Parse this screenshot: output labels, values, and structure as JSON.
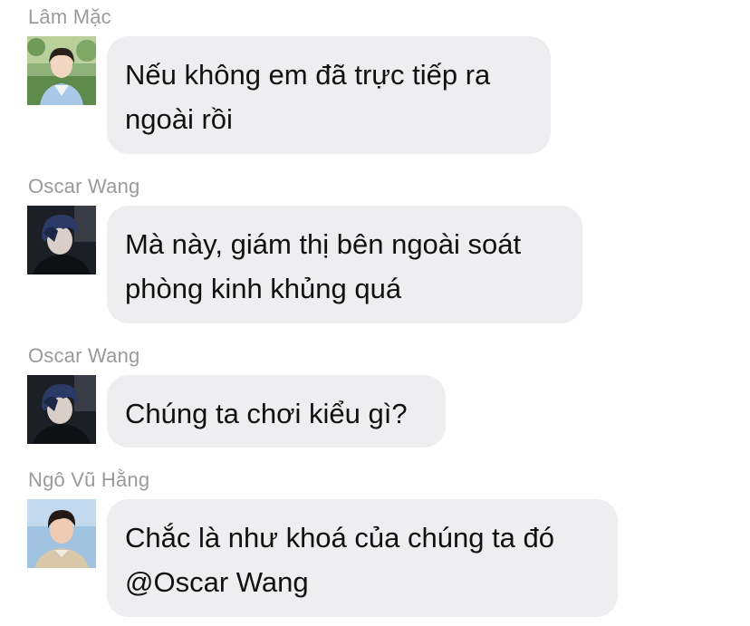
{
  "messages": [
    {
      "sender": "Lâm Mặc",
      "avatar": "young-man-light-shirt-outdoors-avatar",
      "lines": [
        "Nếu không em đã trực tiếp ra",
        "ngoài rồi"
      ]
    },
    {
      "sender": "Oscar Wang",
      "avatar": "dark-haired-man-dark-selfie-avatar",
      "lines": [
        "Mà này, giám thị bên ngoài soát",
        "phòng kinh khủng quá"
      ]
    },
    {
      "sender": "Oscar Wang",
      "avatar": "dark-haired-man-dark-selfie-avatar",
      "lines": [
        "Chúng ta chơi kiểu gì?"
      ]
    },
    {
      "sender": "Ngô Vũ Hằng",
      "avatar": "young-man-sky-background-avatar",
      "lines": [
        "Chắc là như khoá của chúng ta đó",
        "@Oscar Wang"
      ]
    }
  ],
  "colors": {
    "bubble": "#eeeef0",
    "sender_name": "#9a9a9e",
    "message_text": "#111111"
  }
}
